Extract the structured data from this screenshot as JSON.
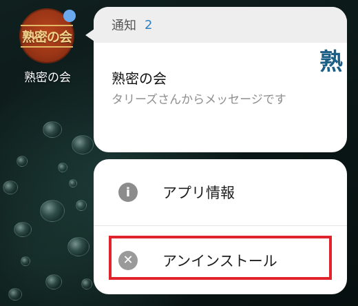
{
  "app": {
    "name": "熟密の会",
    "icon_text": "熟密の会",
    "badge_color": "#6aa9ee",
    "icon_color": "#9a3516"
  },
  "notification": {
    "header_label": "通知",
    "count": "2",
    "title": "熟密の会",
    "message": "タリーズさんからメッセージです",
    "thumbnail_text": "熟"
  },
  "actions": {
    "app_info_label": "アプリ情報",
    "app_info_icon": "info-icon",
    "uninstall_label": "アンインストール",
    "uninstall_icon": "close-circle-icon",
    "highlight_color": "#e0222a"
  }
}
